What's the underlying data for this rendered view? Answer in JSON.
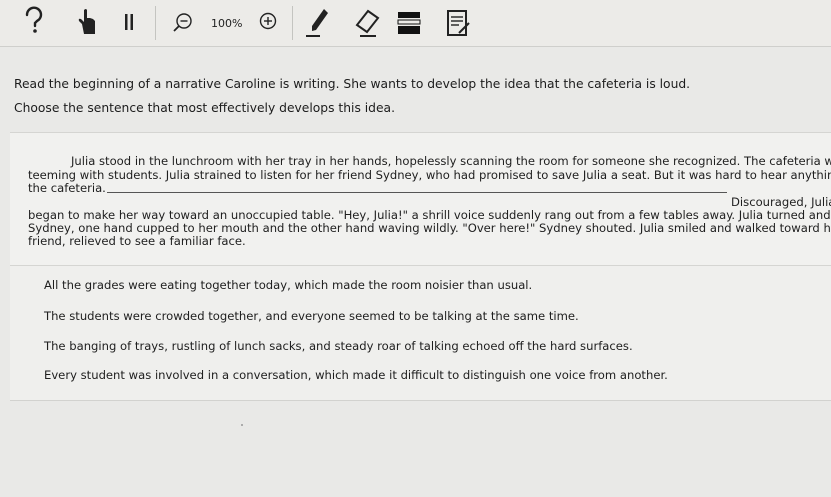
{
  "toolbar": {
    "zoom_label": "100%",
    "icons": [
      "help-icon",
      "pointer-hand-icon",
      "pause-icon",
      "zoom-out-icon",
      "zoom-in-icon",
      "highlighter-icon",
      "eraser-icon",
      "line-reader-icon",
      "notepad-icon"
    ]
  },
  "question": {
    "prompt": "Read the beginning of a narrative Caroline is writing. She wants to develop the idea that the cafeteria is loud.",
    "instruction": "Choose the sentence that most effectively develops this idea."
  },
  "passage": {
    "lines": [
      "Julia stood in the lunchroom with her tray in her hands, hopelessly scanning the room for someone she recognized. The cafeteria was",
      "teeming with students. Julia strained to listen for her friend Sydney, who had promised to save Julia a seat. But it was hard to hear anything in",
      "the cafeteria.",
      "Discouraged, Julia",
      "began to make her way toward an unoccupied table. \"Hey, Julia!\" a shrill voice suddenly rang out from a few tables away. Julia turned and saw",
      "Sydney, one hand cupped to her mouth and the other hand waving wildly. \"Over here!\" Sydney shouted. Julia smiled and walked toward her",
      "friend, relieved to see a familiar face."
    ]
  },
  "choices": [
    "All the grades were eating together today, which made the room noisier than usual.",
    "The students were crowded together, and everyone seemed to be talking at the same time.",
    "The banging of trays, rustling of lunch sacks, and steady roar of talking echoed off the hard surfaces.",
    "Every student was involved in a conversation, which made it difficult to distinguish one voice from another."
  ]
}
